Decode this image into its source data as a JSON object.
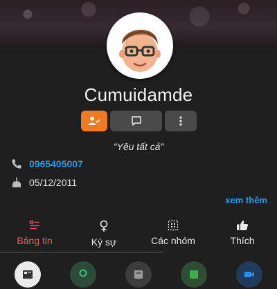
{
  "profile": {
    "name": "Cumuidamde",
    "quote": "“Yêu tất cả”",
    "phone": "0965405007",
    "birthday": "05/12/2011",
    "see_more": "xem thêm"
  },
  "tabs": [
    {
      "label": "Bảng tin",
      "icon": "feed-icon",
      "active": true
    },
    {
      "label": "Ký sự",
      "icon": "chronicle-icon",
      "active": false
    },
    {
      "label": "Các nhóm",
      "icon": "groups-icon",
      "active": false
    },
    {
      "label": "Thích",
      "icon": "thumbs-up-icon",
      "active": false
    }
  ],
  "colors": {
    "accent_orange": "#ef7a24",
    "link_blue": "#2a98e8",
    "active_tab_red": "#e85c5c",
    "background": "#1f1f1f"
  }
}
